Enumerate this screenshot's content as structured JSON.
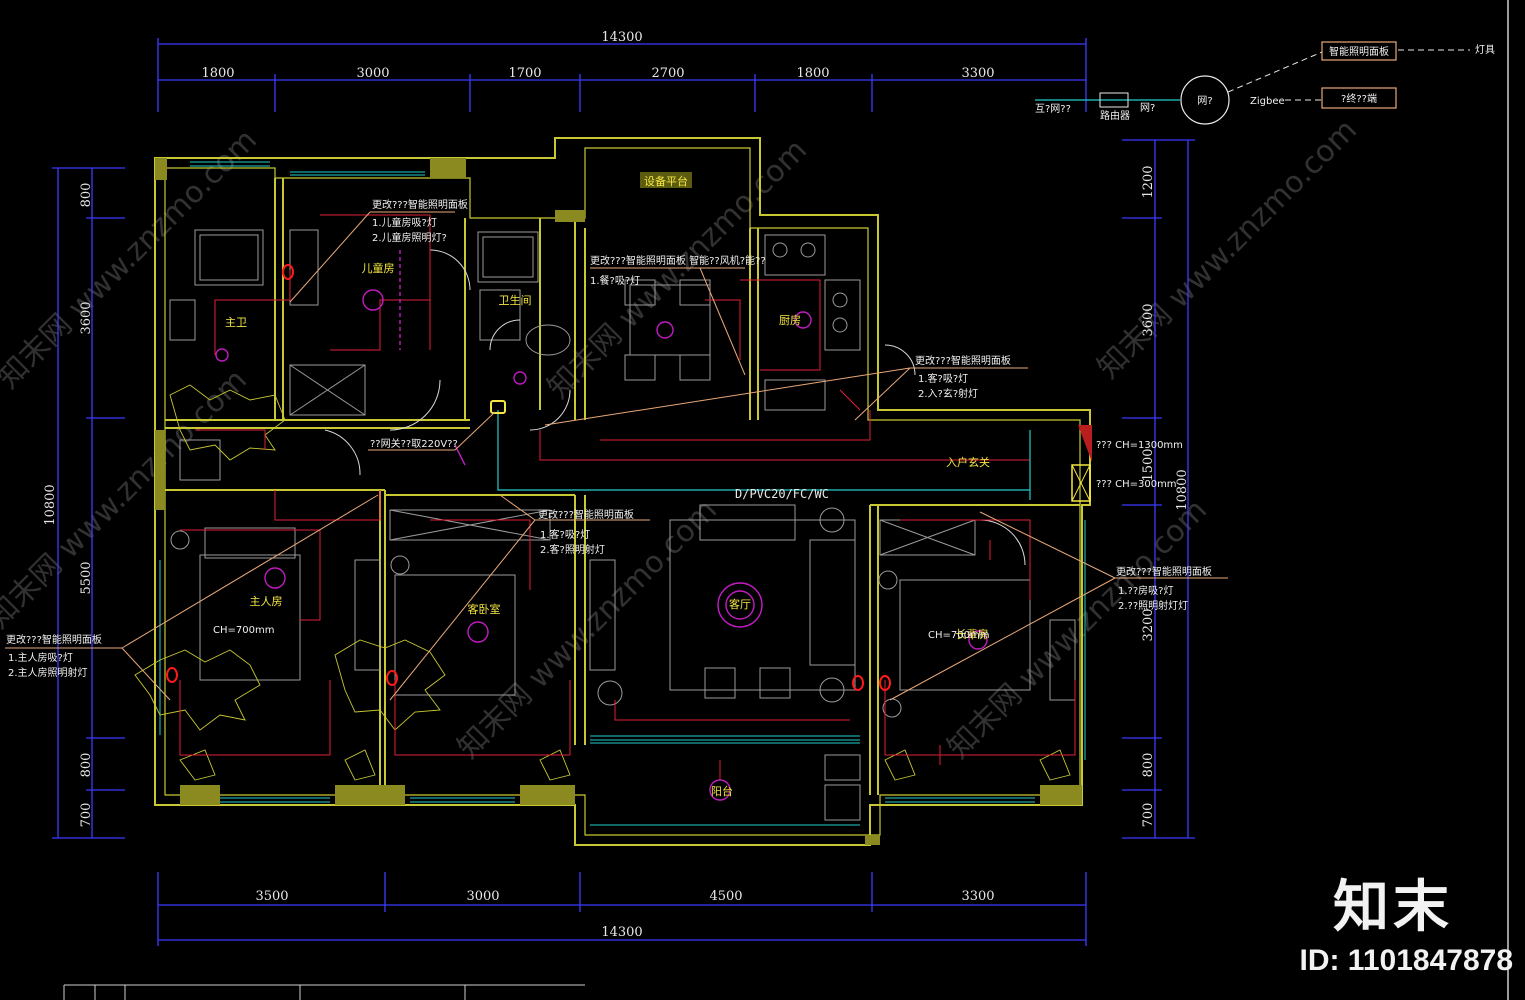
{
  "dims_top_total": "14300",
  "dims_top": [
    "1800",
    "3000",
    "1700",
    "2700",
    "1800",
    "3300"
  ],
  "dims_bottom": [
    "3500",
    "3000",
    "4500",
    "3300"
  ],
  "dims_bottom_total": "14300",
  "dims_left": [
    "800",
    "3600",
    "5500",
    "800",
    "700"
  ],
  "dims_left_total": "10800",
  "dims_right": [
    "1200",
    "3600",
    "1500",
    "3200",
    "800",
    "700"
  ],
  "dims_right_total": "10800",
  "legend": {
    "smart_panel": "智能照明面板",
    "lamp": "灯具",
    "router_label": "路由器",
    "left_text": "互?网??",
    "mid_text": "网?",
    "gateway": "网?",
    "zigbee": "Zigbee",
    "device": "?终??端"
  },
  "rooms": {
    "equipment_platform": "设备平台",
    "child_room": "儿童房",
    "master_bath": "主卫",
    "guest_bath": "卫生间",
    "kitchen": "厨房",
    "master_bedroom": "主人房",
    "guest_bedroom": "客卧室",
    "elder_room": "长辈房",
    "balcony": "阳台",
    "entry_label": "入户玄关",
    "living_room": "客厅"
  },
  "annotations": {
    "child_a": "更改???智能照明面板",
    "child_b": "1.儿童房吸?灯",
    "child_c": "2.儿童房照明灯?",
    "dining_a": "更改???智能照明面板  智能??风机?能??",
    "dining_b": "1.餐?吸?灯",
    "entry_a": "更改???智能照明面板",
    "entry_b": "1.客?吸?灯",
    "entry_c": "2.入?玄?射灯",
    "mid_a": "更改???智能照明面板",
    "mid_b": "1.客?吸?灯",
    "mid_c": "2.客?照明射灯",
    "left_a": "更改???智能照明面板",
    "left_b": "1.主人房吸?灯",
    "left_c": "2.主人房照明射灯",
    "right_a": "更改???智能照明面板",
    "right_b": "1.??房吸?灯",
    "right_c": "2.??照明射灯灯",
    "power_note": "??网关??取220V??",
    "cable_note": "D/PVC20/FC/WC",
    "panel_right1": "??? CH=1300mm",
    "panel_right2": "??? CH=300mm",
    "ch_700_a": "CH=700mm",
    "ch_700_b": "CH=700mm"
  },
  "watermark": "知末网 www.znzmo.com",
  "brand": {
    "name": "知末",
    "id": "ID: 1101847878"
  },
  "colors": {
    "wall": "#c8c832",
    "dimension": "#3b3bff",
    "wiring_red": "#e0203a",
    "cyan": "#22cccc",
    "magenta": "#c01cc0",
    "annotation": "#e8a878"
  }
}
